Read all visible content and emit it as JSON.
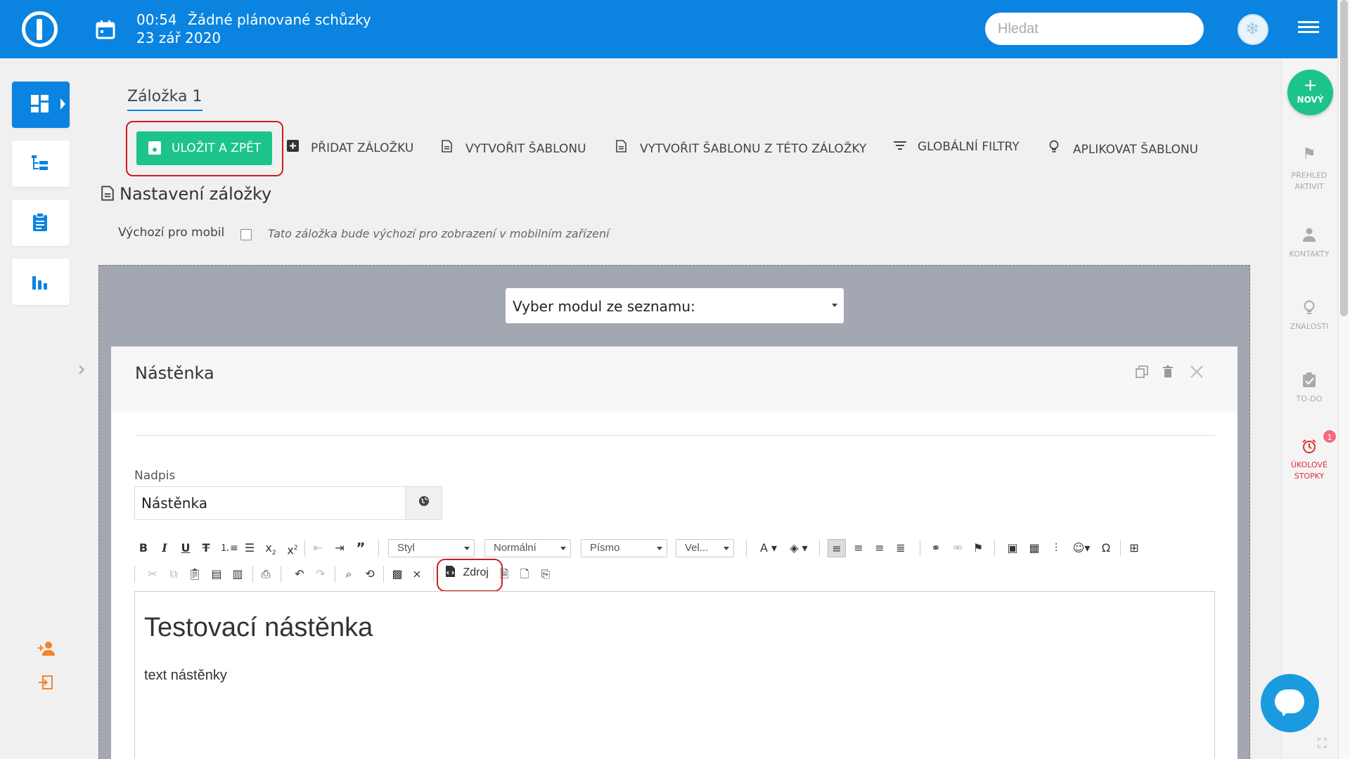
{
  "header": {
    "time": "00:54",
    "meetings_text": "Žádné plánované schůzky",
    "date": "23 zář 2020",
    "search_placeholder": "Hledat"
  },
  "tab": {
    "title": "Záložka 1"
  },
  "toolbar": {
    "save_back": "ULOŽIT A ZPĚT",
    "add_tab": "PŘIDAT ZÁLOŽKU",
    "create_template": "VYTVOŘIT ŠABLONU",
    "create_template_from_tab": "VYTVOŘIT ŠABLONU Z TÉTO ZÁLOŽKY",
    "global_filters": "GLOBÁLNÍ FILTRY",
    "apply_template": "APLIKOVAT ŠABLONU"
  },
  "settings": {
    "title": "Nastavení záložky",
    "mobile_label": "Výchozí pro mobil",
    "mobile_hint": "Tato záložka bude výchozí pro zobrazení v mobilním zařízení",
    "mobile_checked": false
  },
  "module_select": {
    "value": "Vyber modul ze seznamu:"
  },
  "card": {
    "title": "Nástěnka",
    "heading_label": "Nadpis",
    "heading_value": "Nástěnka"
  },
  "editor_toolbar": {
    "style": "Styl",
    "format": "Normální",
    "font": "Písmo",
    "size": "Vel...",
    "source": "Zdroj"
  },
  "editor": {
    "heading": "Testovací nástěnka",
    "body": "text nástěnky"
  },
  "right_sidebar": {
    "new": "NOVÝ",
    "items": [
      "PŘEHLED AKTIVIT",
      "KONTAKTY",
      "ZNALOSTI",
      "TO-DO",
      "ÚKOLOVÉ STOPKY"
    ],
    "timer_badge": "1"
  },
  "colors": {
    "primary": "#0a84e0",
    "success": "#1cc38b",
    "highlight": "#d01c1c",
    "accent_orange": "#f0842c"
  }
}
